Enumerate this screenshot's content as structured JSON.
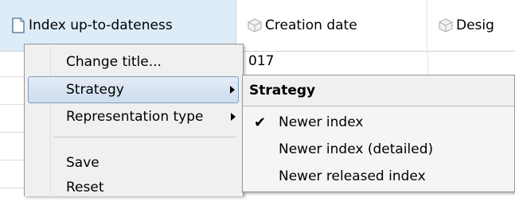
{
  "table": {
    "columns": [
      {
        "label": "Index up-to-dateness",
        "icon": "document-icon",
        "selected": true
      },
      {
        "label": "Creation date",
        "icon": "cube-icon",
        "selected": false
      },
      {
        "label": "Desig",
        "icon": "cube-icon",
        "selected": false
      }
    ],
    "visible_cell": "017"
  },
  "context_menu": {
    "items": [
      {
        "label": "Change title...",
        "has_submenu": false,
        "highlighted": false
      },
      {
        "label": "Strategy",
        "has_submenu": true,
        "highlighted": true
      },
      {
        "label": "Representation type",
        "has_submenu": true,
        "highlighted": false
      },
      {
        "label": "Save",
        "has_submenu": false,
        "highlighted": false
      },
      {
        "label": "Reset",
        "has_submenu": false,
        "highlighted": false
      }
    ]
  },
  "submenu": {
    "title": "Strategy",
    "items": [
      {
        "label": "Newer index",
        "checked": true,
        "check_glyph": "✔"
      },
      {
        "label": "Newer index (detailed)",
        "checked": false,
        "check_glyph": ""
      },
      {
        "label": "Newer released index",
        "checked": false,
        "check_glyph": ""
      }
    ]
  }
}
